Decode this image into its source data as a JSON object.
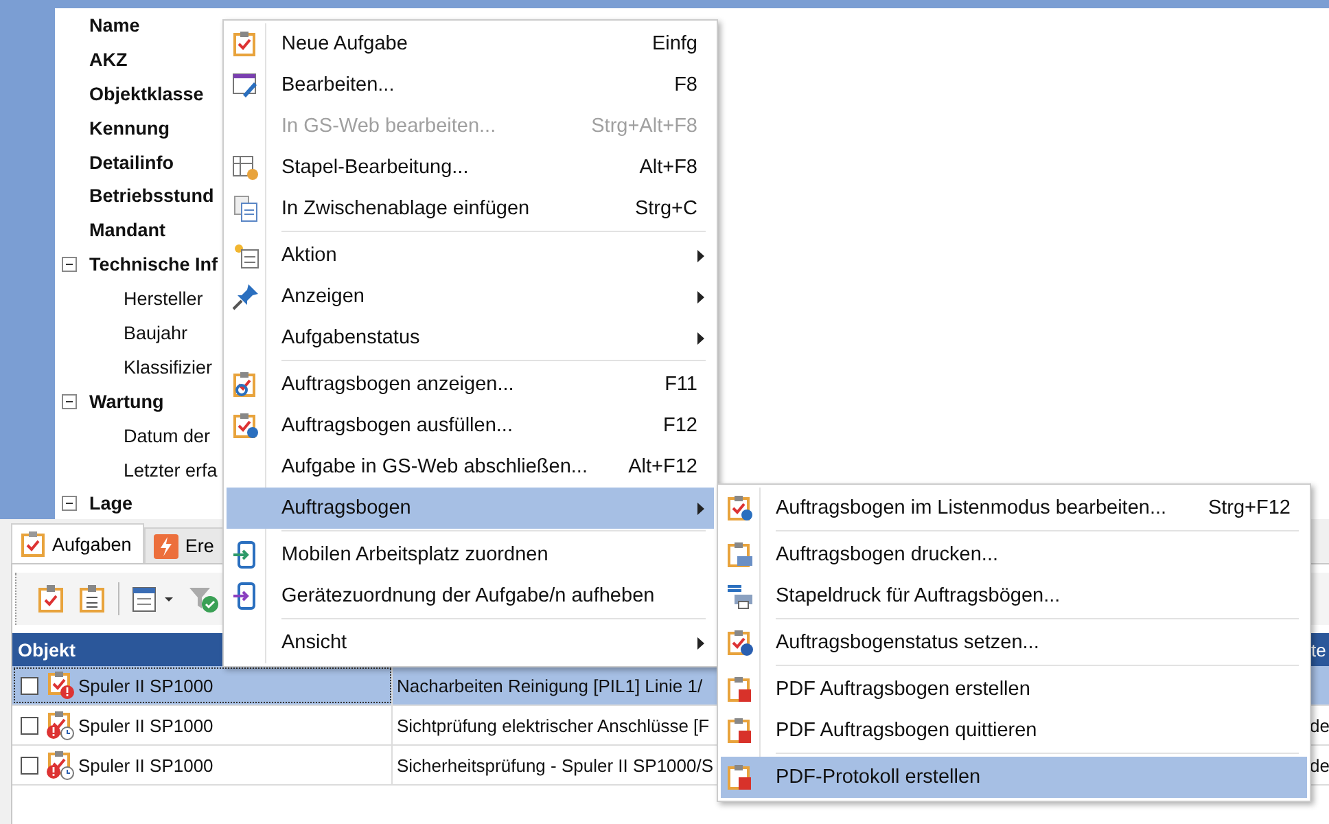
{
  "properties": [
    {
      "label": "Name",
      "kind": "field"
    },
    {
      "label": "AKZ",
      "kind": "field"
    },
    {
      "label": "Objektklasse",
      "kind": "field"
    },
    {
      "label": "Kennung",
      "kind": "field"
    },
    {
      "label": "Detailinfo",
      "kind": "field"
    },
    {
      "label": "Betriebsstund",
      "kind": "field"
    },
    {
      "label": "Mandant",
      "kind": "field"
    },
    {
      "label": "Technische Inf",
      "kind": "group",
      "expanded": true,
      "children": [
        {
          "label": "Hersteller"
        },
        {
          "label": "Baujahr"
        },
        {
          "label": "Klassifizier"
        }
      ]
    },
    {
      "label": "Wartung",
      "kind": "group",
      "expanded": true,
      "children": [
        {
          "label": "Datum der"
        },
        {
          "label": "Letzter erfa"
        }
      ]
    },
    {
      "label": "Lage",
      "kind": "group",
      "expanded": true
    }
  ],
  "tabs": [
    {
      "label": "Aufgaben",
      "selected": true
    },
    {
      "label": "Ere",
      "selected": false
    }
  ],
  "table": {
    "columns": [
      "Objekt",
      "te"
    ],
    "rows": [
      {
        "objekt": "Spuler II SP1000",
        "text": "Nacharbeiten Reinigung [PIL1] Linie 1/",
        "checked": false,
        "selected": true
      },
      {
        "objekt": "Spuler II SP1000",
        "text": "Sichtprüfung elektrischer Anschlüsse [F",
        "column_3": "de",
        "checked": false,
        "selected": false
      },
      {
        "objekt": "Spuler II SP1000",
        "text": "Sicherheitsprüfung - Spuler II SP1000/S",
        "column_3": "de",
        "checked": false,
        "selected": false
      }
    ]
  },
  "context_menu": [
    {
      "kind": "item",
      "label": "Neue Aufgabe",
      "shortcut": "Einfg",
      "disabled": false,
      "submenu": false,
      "selected": false
    },
    {
      "kind": "item",
      "label": "Bearbeiten...",
      "shortcut": "F8",
      "disabled": false,
      "submenu": false,
      "selected": false
    },
    {
      "kind": "item",
      "label": "In GS-Web bearbeiten...",
      "shortcut": "Strg+Alt+F8",
      "disabled": true,
      "submenu": false,
      "selected": false
    },
    {
      "kind": "item",
      "label": "Stapel-Bearbeitung...",
      "shortcut": "Alt+F8",
      "disabled": false,
      "submenu": false,
      "selected": false
    },
    {
      "kind": "item",
      "label": "In Zwischenablage einfügen",
      "shortcut": "Strg+C",
      "disabled": false,
      "submenu": false,
      "selected": false
    },
    {
      "kind": "separator"
    },
    {
      "kind": "item",
      "label": "Aktion",
      "disabled": false,
      "submenu": true,
      "selected": false
    },
    {
      "kind": "item",
      "label": "Anzeigen",
      "disabled": false,
      "submenu": true,
      "selected": false
    },
    {
      "kind": "item",
      "label": "Aufgabenstatus",
      "disabled": false,
      "submenu": true,
      "selected": false
    },
    {
      "kind": "separator"
    },
    {
      "kind": "item",
      "label": "Auftragsbogen anzeigen...",
      "shortcut": "F11",
      "disabled": false,
      "submenu": false,
      "selected": false
    },
    {
      "kind": "item",
      "label": "Auftragsbogen ausfüllen...",
      "shortcut": "F12",
      "disabled": false,
      "submenu": false,
      "selected": false
    },
    {
      "kind": "item",
      "label": "Aufgabe in GS-Web abschließen...",
      "shortcut": "Alt+F12",
      "disabled": false,
      "submenu": false,
      "selected": false
    },
    {
      "kind": "item",
      "label": "Auftragsbogen",
      "disabled": false,
      "submenu": true,
      "selected": true
    },
    {
      "kind": "separator"
    },
    {
      "kind": "item",
      "label": "Mobilen Arbeitsplatz zuordnen",
      "disabled": false,
      "submenu": false,
      "selected": false
    },
    {
      "kind": "item",
      "label": "Gerätezuordnung der Aufgabe/n aufheben",
      "disabled": false,
      "submenu": false,
      "selected": false
    },
    {
      "kind": "separator"
    },
    {
      "kind": "item",
      "label": "Ansicht",
      "disabled": false,
      "submenu": true,
      "selected": false
    }
  ],
  "submenu": [
    {
      "kind": "item",
      "label": "Auftragsbogen im Listenmodus bearbeiten...",
      "shortcut": "Strg+F12",
      "selected": false
    },
    {
      "kind": "separator"
    },
    {
      "kind": "item",
      "label": "Auftragsbogen drucken...",
      "selected": false
    },
    {
      "kind": "item",
      "label": "Stapeldruck für Auftragsbögen...",
      "selected": false
    },
    {
      "kind": "separator"
    },
    {
      "kind": "item",
      "label": "Auftragsbogenstatus setzen...",
      "selected": false
    },
    {
      "kind": "separator"
    },
    {
      "kind": "item",
      "label": "PDF Auftragsbogen erstellen",
      "selected": false
    },
    {
      "kind": "item",
      "label": "PDF Auftragsbogen quittieren",
      "selected": false
    },
    {
      "kind": "separator"
    },
    {
      "kind": "item",
      "label": "PDF-Protokoll erstellen",
      "selected": true
    }
  ]
}
